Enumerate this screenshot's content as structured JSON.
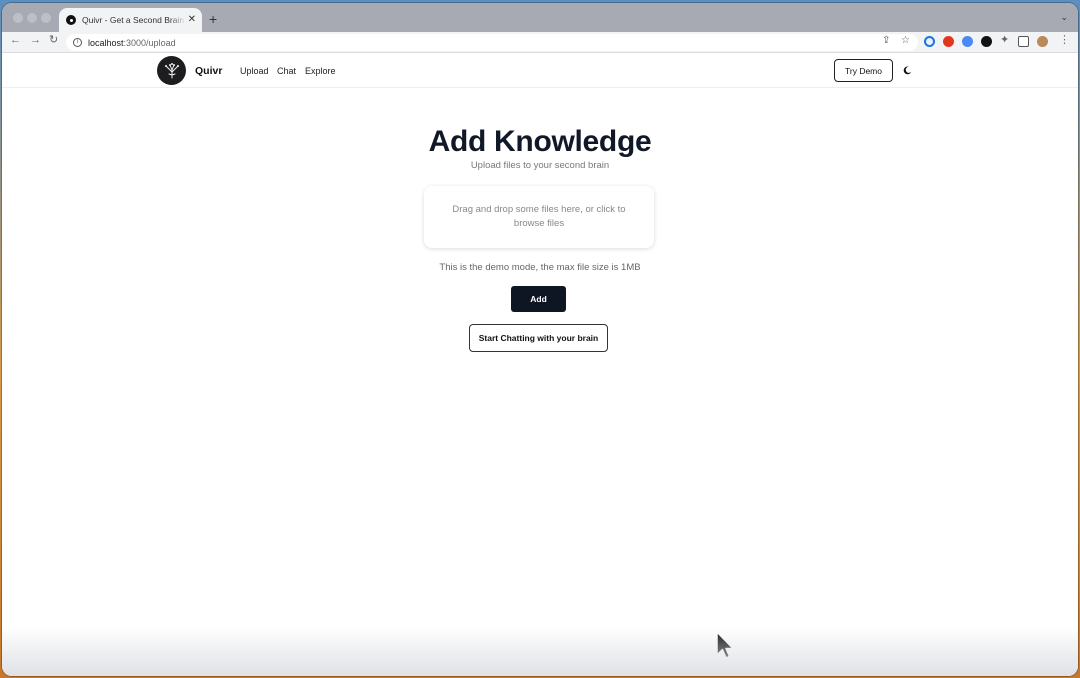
{
  "browser": {
    "tab_title": "Quivr - Get a Second Brain with Generative AI",
    "tab_close": "✕",
    "new_tab": "+",
    "url_host": "localhost",
    "url_path": ":3000/upload"
  },
  "header": {
    "brand": "Quivr",
    "nav": [
      "Upload",
      "Chat",
      "Explore"
    ],
    "try_demo": "Try Demo"
  },
  "main": {
    "title": "Add Knowledge",
    "subtitle": "Upload files to your second brain",
    "dropzone_text": "Drag and drop some files here, or click to browse files",
    "demo_note": "This is the demo mode, the max file size is 1MB",
    "add_button": "Add",
    "chat_button": "Start Chatting with your brain"
  },
  "colors": {
    "primary_button": "#0f1623",
    "title": "#111827"
  },
  "icons": {
    "theme_toggle": "moon-icon",
    "logo": "brain-tree-icon"
  }
}
